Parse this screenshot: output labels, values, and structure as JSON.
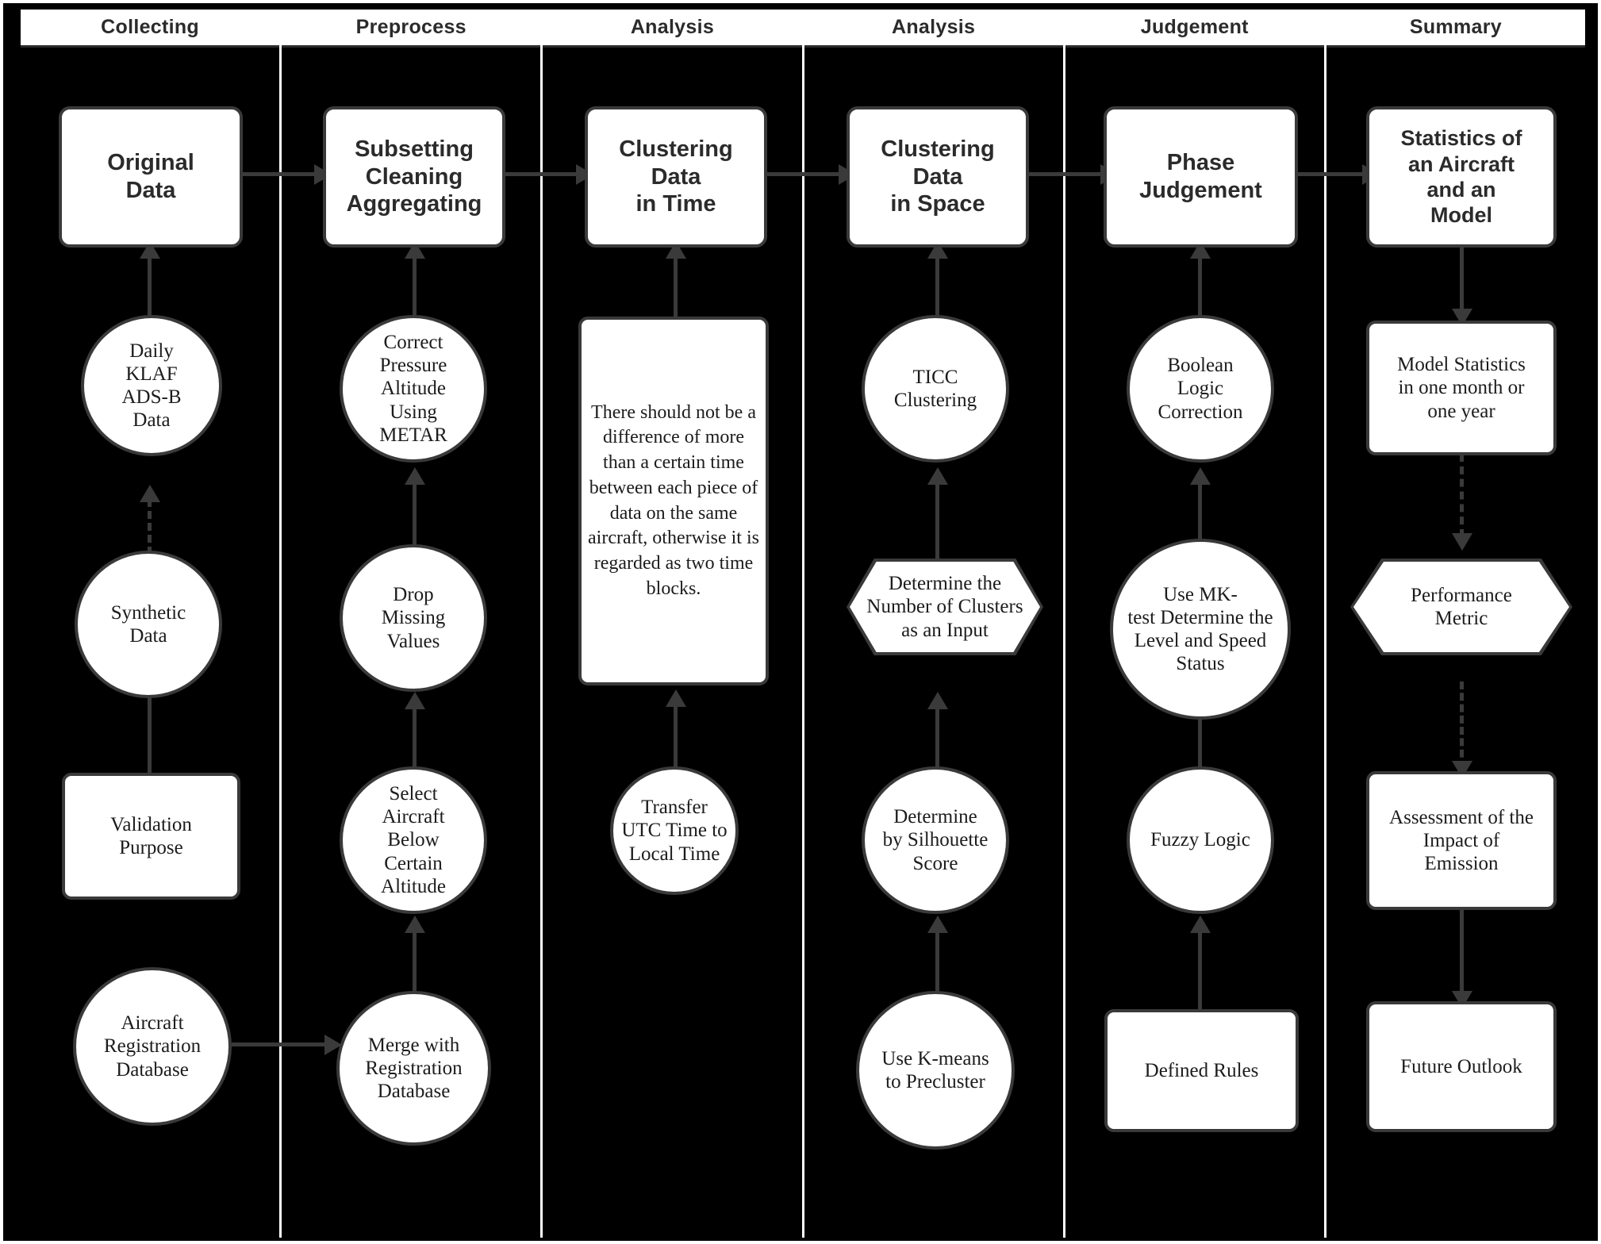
{
  "diagram": {
    "title": "Aircraft ADS-B Data Processing and Phase Judgement Pipeline",
    "background_color": "#000000",
    "node_fill": "#ffffff",
    "node_stroke": "#3a3a3a",
    "lane_divider_color": "#ffffff"
  },
  "lanes": [
    {
      "id": "collecting",
      "header": "Collecting"
    },
    {
      "id": "preprocess",
      "header": "Preprocess"
    },
    {
      "id": "analysis_time",
      "header": "Analysis"
    },
    {
      "id": "analysis_space",
      "header": "Analysis"
    },
    {
      "id": "judgement",
      "header": "Judgement"
    },
    {
      "id": "summary",
      "header": "Summary"
    }
  ],
  "nodes": {
    "c1_primary": "Original\nData",
    "c1_n1": "Daily\nKLAF\nADS-B\nData",
    "c1_n2": "Synthetic\nData",
    "c1_n3": "Validation\nPurpose",
    "c1_n4": "Aircraft\nRegistration\nDatabase",
    "c2_primary": "Subsetting\nCleaning\nAggregating",
    "c2_n1": "Correct\nPressure\nAltitude\nUsing\nMETAR",
    "c2_n2": "Drop\nMissing\nValues",
    "c2_n3": "Select\nAircraft\nBelow\nCertain\nAltitude",
    "c2_n4": "Merge with\nRegistration\nDatabase",
    "c3_primary": "Clustering\nData\nin Time",
    "c3_n1": "There should not be a difference of more than a certain time between each piece of data on the same aircraft, otherwise it is regarded as two time blocks.",
    "c3_n2": "Transfer\nUTC Time to\nLocal Time",
    "c4_primary": "Clustering\nData\nin Space",
    "c4_n1": "TICC\nClustering",
    "c4_n2": "Determine the\nNumber of Clusters\nas an Input",
    "c4_n3": "Determine\nby Silhouette\nScore",
    "c4_n4": "Use K-means\nto Precluster",
    "c5_primary": "Phase\nJudgement",
    "c5_n1": "Boolean\nLogic\nCorrection",
    "c5_n2": "Use MK-\ntest Determine the\nLevel and Speed\nStatus",
    "c5_n3": "Fuzzy Logic",
    "c5_n4": "Defined Rules",
    "c6_primary": "Statistics of\nan Aircraft\nand an\nModel",
    "c6_n1": "Model Statistics\nin one month or\none year",
    "c6_n2": "Performance\nMetric",
    "c6_n3": "Assessment of the\nImpact of\nEmission",
    "c6_n4": "Future Outlook"
  },
  "shapes": {
    "c1_primary": "rounded-rect",
    "c1_n1": "circle",
    "c1_n2": "circle",
    "c1_n3": "rounded-rect",
    "c1_n4": "circle",
    "c2_primary": "rounded-rect",
    "c2_n1": "circle",
    "c2_n2": "circle",
    "c2_n3": "circle",
    "c2_n4": "circle",
    "c3_primary": "rounded-rect",
    "c3_n1": "rounded-rect",
    "c3_n2": "circle",
    "c4_primary": "rounded-rect",
    "c4_n1": "circle",
    "c4_n2": "hexagon",
    "c4_n3": "circle",
    "c4_n4": "circle",
    "c5_primary": "rounded-rect",
    "c5_n1": "circle",
    "c5_n2": "circle",
    "c5_n3": "circle",
    "c5_n4": "rounded-rect",
    "c6_primary": "rounded-rect",
    "c6_n1": "rounded-rect",
    "c6_n2": "hexagon",
    "c6_n3": "rounded-rect",
    "c6_n4": "rounded-rect"
  },
  "edges": [
    {
      "from": "c1_n1",
      "to": "c1_primary",
      "style": "solid",
      "direction": "up"
    },
    {
      "from": "c1_n2",
      "to": "c1_n1",
      "style": "dashed",
      "direction": "up"
    },
    {
      "from": "c1_n3",
      "to": "c1_n2",
      "style": "solid",
      "direction": "up"
    },
    {
      "from": "c1_n4",
      "to": "c2_n4",
      "style": "solid",
      "direction": "right"
    },
    {
      "from": "c1_primary",
      "to": "c2_primary",
      "style": "solid",
      "direction": "right"
    },
    {
      "from": "c2_n1",
      "to": "c2_primary",
      "style": "solid",
      "direction": "up"
    },
    {
      "from": "c2_n2",
      "to": "c2_n1",
      "style": "solid",
      "direction": "up"
    },
    {
      "from": "c2_n3",
      "to": "c2_n2",
      "style": "solid",
      "direction": "up"
    },
    {
      "from": "c2_n4",
      "to": "c2_n3",
      "style": "solid",
      "direction": "up"
    },
    {
      "from": "c2_primary",
      "to": "c3_primary",
      "style": "solid",
      "direction": "right"
    },
    {
      "from": "c3_n1",
      "to": "c3_primary",
      "style": "solid",
      "direction": "up"
    },
    {
      "from": "c3_n2",
      "to": "c3_n1",
      "style": "solid",
      "direction": "up"
    },
    {
      "from": "c3_primary",
      "to": "c4_primary",
      "style": "solid",
      "direction": "right"
    },
    {
      "from": "c4_n1",
      "to": "c4_primary",
      "style": "solid",
      "direction": "up"
    },
    {
      "from": "c4_n2",
      "to": "c4_n1",
      "style": "solid",
      "direction": "up"
    },
    {
      "from": "c4_n3",
      "to": "c4_n2",
      "style": "solid",
      "direction": "up"
    },
    {
      "from": "c4_n4",
      "to": "c4_n3",
      "style": "solid",
      "direction": "up"
    },
    {
      "from": "c4_primary",
      "to": "c5_primary",
      "style": "solid",
      "direction": "right"
    },
    {
      "from": "c5_n1",
      "to": "c5_primary",
      "style": "solid",
      "direction": "up"
    },
    {
      "from": "c5_n2",
      "to": "c5_n1",
      "style": "solid",
      "direction": "up"
    },
    {
      "from": "c5_n3",
      "to": "c5_n2",
      "style": "solid",
      "direction": "up"
    },
    {
      "from": "c5_n4",
      "to": "c5_n3",
      "style": "solid",
      "direction": "up"
    },
    {
      "from": "c5_primary",
      "to": "c6_primary",
      "style": "solid",
      "direction": "right"
    },
    {
      "from": "c6_primary",
      "to": "c6_n1",
      "style": "solid",
      "direction": "down"
    },
    {
      "from": "c6_n1",
      "to": "c6_n2",
      "style": "dashed",
      "direction": "down"
    },
    {
      "from": "c6_n2",
      "to": "c6_n3",
      "style": "dashed",
      "direction": "down"
    },
    {
      "from": "c6_n3",
      "to": "c6_n4",
      "style": "solid",
      "direction": "down"
    }
  ]
}
